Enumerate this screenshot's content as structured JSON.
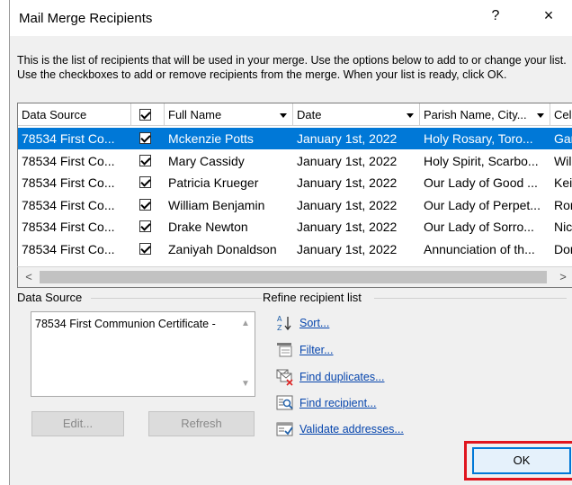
{
  "window": {
    "title": "Mail Merge Recipients",
    "help_label": "?",
    "close_label": "×"
  },
  "description": "This is the list of recipients that will be used in your merge.  Use the options below to add to or change your list.  Use the checkboxes to add or remove recipients from the merge.  When your list is ready, click OK.",
  "grid": {
    "columns": [
      "Data Source",
      "",
      "Full Name",
      "Date",
      "Parish Name, City...",
      "Cele"
    ],
    "rows": [
      {
        "source": "78534 First Co...",
        "checked": true,
        "name": "Mckenzie Potts",
        "date": "January 1st, 2022",
        "parish": "Holy Rosary, Toro...",
        "cele": "Gar",
        "selected": true
      },
      {
        "source": "78534 First Co...",
        "checked": true,
        "name": "Mary Cassidy",
        "date": "January 1st, 2022",
        "parish": "Holy Spirit, Scarbo...",
        "cele": "Will",
        "selected": false
      },
      {
        "source": "78534 First Co...",
        "checked": true,
        "name": "Patricia Krueger",
        "date": "January 1st, 2022",
        "parish": "Our Lady of Good ...",
        "cele": "Keit",
        "selected": false
      },
      {
        "source": "78534 First Co...",
        "checked": true,
        "name": "William Benjamin",
        "date": "January 1st, 2022",
        "parish": "Our Lady of Perpet...",
        "cele": "Ron",
        "selected": false
      },
      {
        "source": "78534 First Co...",
        "checked": true,
        "name": "Drake Newton",
        "date": "January 1st, 2022",
        "parish": "Our Lady of Sorro...",
        "cele": "Nicl",
        "selected": false
      },
      {
        "source": "78534 First Co...",
        "checked": true,
        "name": "Zaniyah Donaldson",
        "date": "January 1st, 2022",
        "parish": "Annunciation of th...",
        "cele": "Dor",
        "selected": false
      }
    ],
    "scroll_left": "<",
    "scroll_right": ">"
  },
  "data_source": {
    "label": "Data Source",
    "item": "78534 First Communion Certificate -",
    "edit_label": "Edit...",
    "refresh_label": "Refresh"
  },
  "refine": {
    "label": "Refine recipient list",
    "items": [
      {
        "label": "Sort...",
        "icon": "sort-az-icon"
      },
      {
        "label": "Filter...",
        "icon": "filter-icon"
      },
      {
        "label": "Find duplicates...",
        "icon": "find-duplicates-icon"
      },
      {
        "label": "Find recipient...",
        "icon": "find-recipient-icon"
      },
      {
        "label": "Validate addresses...",
        "icon": "validate-addresses-icon"
      }
    ]
  },
  "ok_label": "OK",
  "colors": {
    "selection": "#0078d7",
    "link": "#0645ad",
    "highlight_outline": "#e0151e"
  }
}
